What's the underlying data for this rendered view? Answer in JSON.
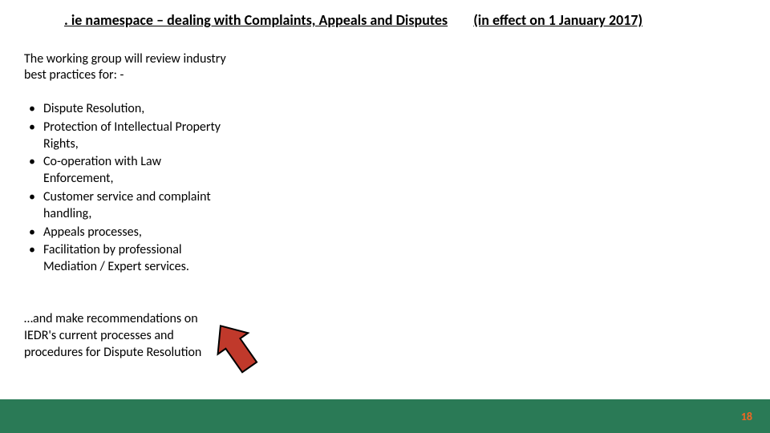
{
  "title": {
    "main": ". ie namespace – dealing with Complaints, Appeals and Disputes",
    "note": "(in effect on 1 January 2017)"
  },
  "intro": "The working group will review industry best practices for: -",
  "bullets": [
    "Dispute Resolution,",
    "Protection of Intellectual Property Rights,",
    "Co-operation with Law Enforcement,",
    "Customer service and complaint handling,",
    "Appeals processes,",
    "Facilitation by professional Mediation / Expert services."
  ],
  "outro": "…and make recommendations on IEDR's current processes and procedures for Dispute Resolution",
  "pageNumber": "18",
  "colors": {
    "footer": "#2a7a56",
    "arrowFill": "#c0392b",
    "arrowStroke": "#000000",
    "pageNum": "#f26522"
  }
}
